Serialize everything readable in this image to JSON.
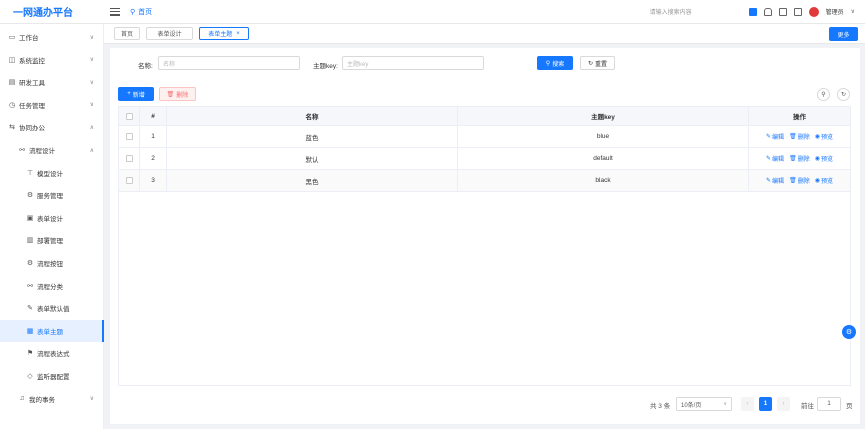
{
  "app": {
    "title": "一网通办平台"
  },
  "header": {
    "home_label": "首页",
    "search_placeholder": "请输入搜索内容",
    "user_name": "管理员",
    "caret": "∨"
  },
  "sidebar": {
    "items": [
      {
        "label": "工作台",
        "icon": "▭",
        "level": 0,
        "chev": "∨"
      },
      {
        "label": "系统监控",
        "icon": "◫",
        "level": 0,
        "chev": "∨"
      },
      {
        "label": "研发工具",
        "icon": "▤",
        "level": 0,
        "chev": "∨"
      },
      {
        "label": "任务管理",
        "icon": "◷",
        "level": 0,
        "chev": "∨"
      },
      {
        "label": "协同办公",
        "icon": "⇆",
        "level": 0,
        "chev": "∧"
      },
      {
        "label": "流程设计",
        "icon": "⚯",
        "level": 1,
        "chev": "∧"
      },
      {
        "label": "模型设计",
        "icon": "⊤",
        "level": 2,
        "chev": ""
      },
      {
        "label": "服务管理",
        "icon": "⚙",
        "level": 2,
        "chev": ""
      },
      {
        "label": "表单设计",
        "icon": "▣",
        "level": 2,
        "chev": ""
      },
      {
        "label": "部署管理",
        "icon": "▥",
        "level": 2,
        "chev": ""
      },
      {
        "label": "流程按钮",
        "icon": "⚙",
        "level": 2,
        "chev": ""
      },
      {
        "label": "流程分类",
        "icon": "⚯",
        "level": 2,
        "chev": ""
      },
      {
        "label": "表单默认值",
        "icon": "✎",
        "level": 2,
        "chev": ""
      },
      {
        "label": "表单主题",
        "icon": "▦",
        "level": 2,
        "chev": "",
        "active": true
      },
      {
        "label": "流程表达式",
        "icon": "⚑",
        "level": 2,
        "chev": ""
      },
      {
        "label": "监听器配置",
        "icon": "◇",
        "level": 2,
        "chev": ""
      },
      {
        "label": "我的事务",
        "icon": "♫",
        "level": 1,
        "chev": "∨"
      }
    ]
  },
  "tabs": [
    {
      "label": "首页",
      "close": ""
    },
    {
      "label": "表单设计",
      "close": ""
    },
    {
      "label": "表单主题",
      "close": "×",
      "active": true
    }
  ],
  "more_label": "更多",
  "search_form": {
    "name_label": "名称:",
    "name_placeholder": "名称",
    "key_label": "主题key:",
    "key_placeholder": "主题key",
    "search_label": "搜索",
    "reset_label": "重置"
  },
  "toolbar": {
    "add_label": "新增",
    "delete_label": "删除"
  },
  "table": {
    "columns": [
      "#",
      "名称",
      "主题key",
      "操作"
    ],
    "rows": [
      {
        "index": "1",
        "name": "蓝色",
        "key": "blue"
      },
      {
        "index": "2",
        "name": "默认",
        "key": "default"
      },
      {
        "index": "3",
        "name": "黑色",
        "key": "black"
      }
    ],
    "actions": {
      "edit": "编辑",
      "delete": "删除",
      "preview": "预览"
    }
  },
  "pagination": {
    "total_label": "共 3 条",
    "page_size": "10条/页",
    "current_page": "1",
    "goto_label": "前往",
    "goto_value": "1",
    "page_unit": "页",
    "prev": "‹",
    "next": "›"
  },
  "colors": {
    "primary": "#1677ff",
    "danger": "#f56c6c",
    "avatar": "#e03a3a"
  }
}
